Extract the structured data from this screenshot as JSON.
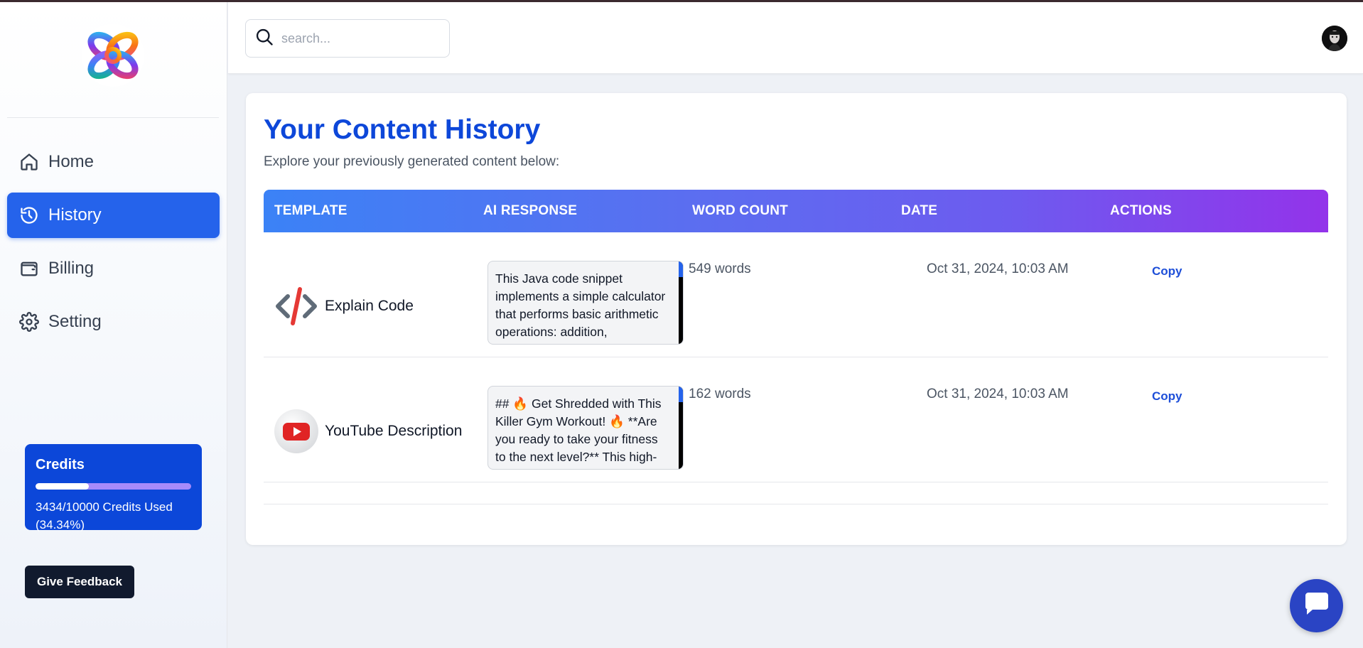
{
  "app": {
    "logo_icon": "knot-logo-icon"
  },
  "sidebar": {
    "items": [
      {
        "label": "Home",
        "icon": "home-icon",
        "active": false
      },
      {
        "label": "History",
        "icon": "history-icon",
        "active": true
      },
      {
        "label": "Billing",
        "icon": "wallet-icon",
        "active": false
      },
      {
        "label": "Setting",
        "icon": "gear-icon",
        "active": false
      }
    ],
    "credits": {
      "title": "Credits",
      "used_text": "3434/10000 Credits Used (34.34%)",
      "used": 3434,
      "total": 10000,
      "percent": 34.34
    },
    "feedback_label": "Give Feedback"
  },
  "header": {
    "search_placeholder": "search..."
  },
  "main": {
    "title": "Your Content History",
    "subtitle": "Explore your previously generated content below:",
    "columns": [
      "TEMPLATE",
      "AI RESPONSE",
      "WORD COUNT",
      "DATE",
      "ACTIONS"
    ],
    "rows": [
      {
        "template": "Explain Code",
        "icon": "code-icon",
        "response": "This Java code snippet implements a simple calculator that performs basic arithmetic operations: addition, subtraction, multiplication, and",
        "words": "549 words",
        "date": "Oct 31, 2024, 10:03 AM",
        "action": "Copy"
      },
      {
        "template": "YouTube Description",
        "icon": "youtube-icon",
        "response": "## 🔥 Get Shredded with This Killer Gym Workout! 🔥 **Are you ready to take your fitness to the next level?** This high-intensity workout will",
        "words": "162 words",
        "date": "Oct 31, 2024, 10:03 AM",
        "action": "Copy"
      }
    ]
  },
  "colors": {
    "primary": "#2563eb",
    "title_blue": "#0d47d9",
    "credits_card": "#0c47d9",
    "header_gradient_start": "#3b82f6",
    "header_gradient_end": "#9333ea",
    "feedback_bg": "#111a2e",
    "chat_bg": "#2a44c4"
  }
}
